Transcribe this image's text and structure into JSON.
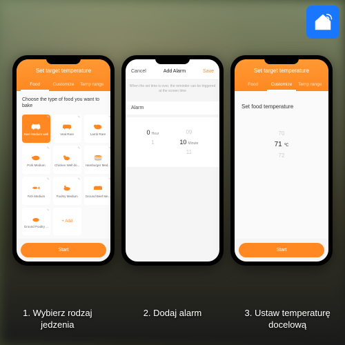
{
  "logo": {
    "name": "smart-home-icon"
  },
  "phone1": {
    "header_title": "Set target temperature",
    "tabs": [
      {
        "label": "Food",
        "active": true
      },
      {
        "label": "Customize",
        "active": false
      },
      {
        "label": "Temp range",
        "active": false
      }
    ],
    "prompt": "Choose the type of food you want to bake",
    "foods": [
      {
        "label": "Beef Medium well",
        "selected": true
      },
      {
        "label": "Veal Rare"
      },
      {
        "label": "Lamb Rare"
      },
      {
        "label": "Pork Medium"
      },
      {
        "label": "Chicken Well do..."
      },
      {
        "label": "Hamburger Med..."
      },
      {
        "label": "Fish Medium"
      },
      {
        "label": "Poultry Medium"
      },
      {
        "label": "Ground Beef Me..."
      },
      {
        "label": "Ground Poultry ..."
      }
    ],
    "add_label": "+ Add",
    "start_label": "Start"
  },
  "phone2": {
    "cancel": "Cancel",
    "title": "Add Alarm",
    "save": "Save",
    "hint": "When the set time is over, the reminder can be triggered at the screen time",
    "section_label": "Alarm",
    "hour": {
      "prev": "",
      "sel": "0",
      "next": "1",
      "unit": "Hour"
    },
    "minute": {
      "prev": "09",
      "sel": "10",
      "next": "11",
      "unit": "Minute"
    }
  },
  "phone3": {
    "header_title": "Set target temperature",
    "tabs": [
      {
        "label": "Food",
        "active": false
      },
      {
        "label": "Customize",
        "active": true
      },
      {
        "label": "Temp range",
        "active": false
      }
    ],
    "prompt": "Set food temperature",
    "temp": {
      "prev": "70",
      "sel": "71",
      "next": "72",
      "unit": "℃"
    },
    "start_label": "Start"
  },
  "captions": {
    "c1": "1. Wybierz rodzaj jedzenia",
    "c2": "2. Dodaj alarm",
    "c3": "3. Ustaw temperaturę docelową"
  }
}
